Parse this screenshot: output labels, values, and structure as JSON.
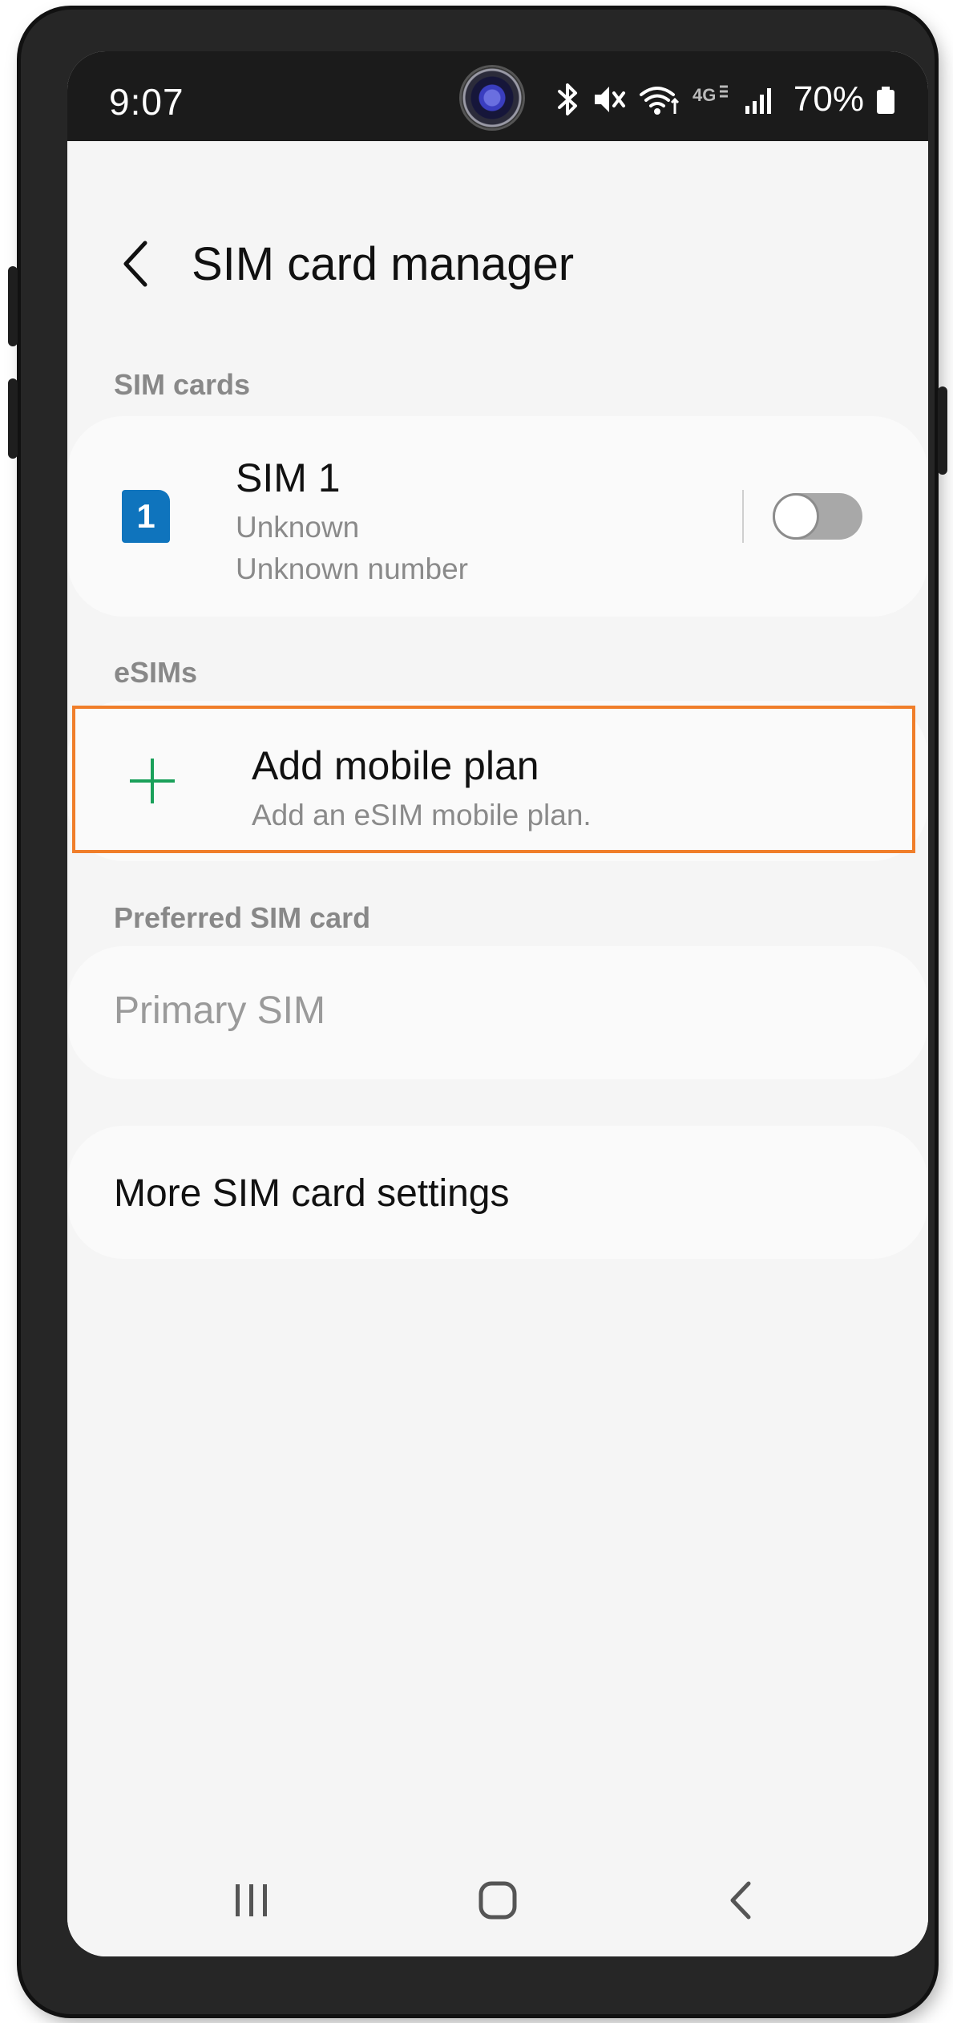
{
  "status_bar": {
    "time": "9:07",
    "battery_percent": "70%",
    "icons": [
      "bluetooth-icon",
      "mute-icon",
      "wifi-icon",
      "4g-icon",
      "signal-icon",
      "battery-icon"
    ]
  },
  "header": {
    "title": "SIM card manager"
  },
  "sim_cards": {
    "section_label": "SIM cards",
    "sim1": {
      "badge": "1",
      "name": "SIM 1",
      "carrier": "Unknown",
      "number": "Unknown number",
      "enabled": false
    }
  },
  "esims": {
    "section_label": "eSIMs",
    "add_plan": {
      "title": "Add mobile plan",
      "subtitle": "Add an eSIM mobile plan."
    }
  },
  "preferred": {
    "section_label": "Preferred SIM card",
    "primary_sim_label": "Primary SIM"
  },
  "more_settings": {
    "label": "More SIM card settings"
  },
  "nav_bar": {
    "buttons": [
      "recent-apps",
      "home",
      "back"
    ]
  },
  "colors": {
    "accent_highlight": "#f07e2a",
    "sim_badge": "#0f74bd",
    "plus_green": "#1aa05a"
  }
}
